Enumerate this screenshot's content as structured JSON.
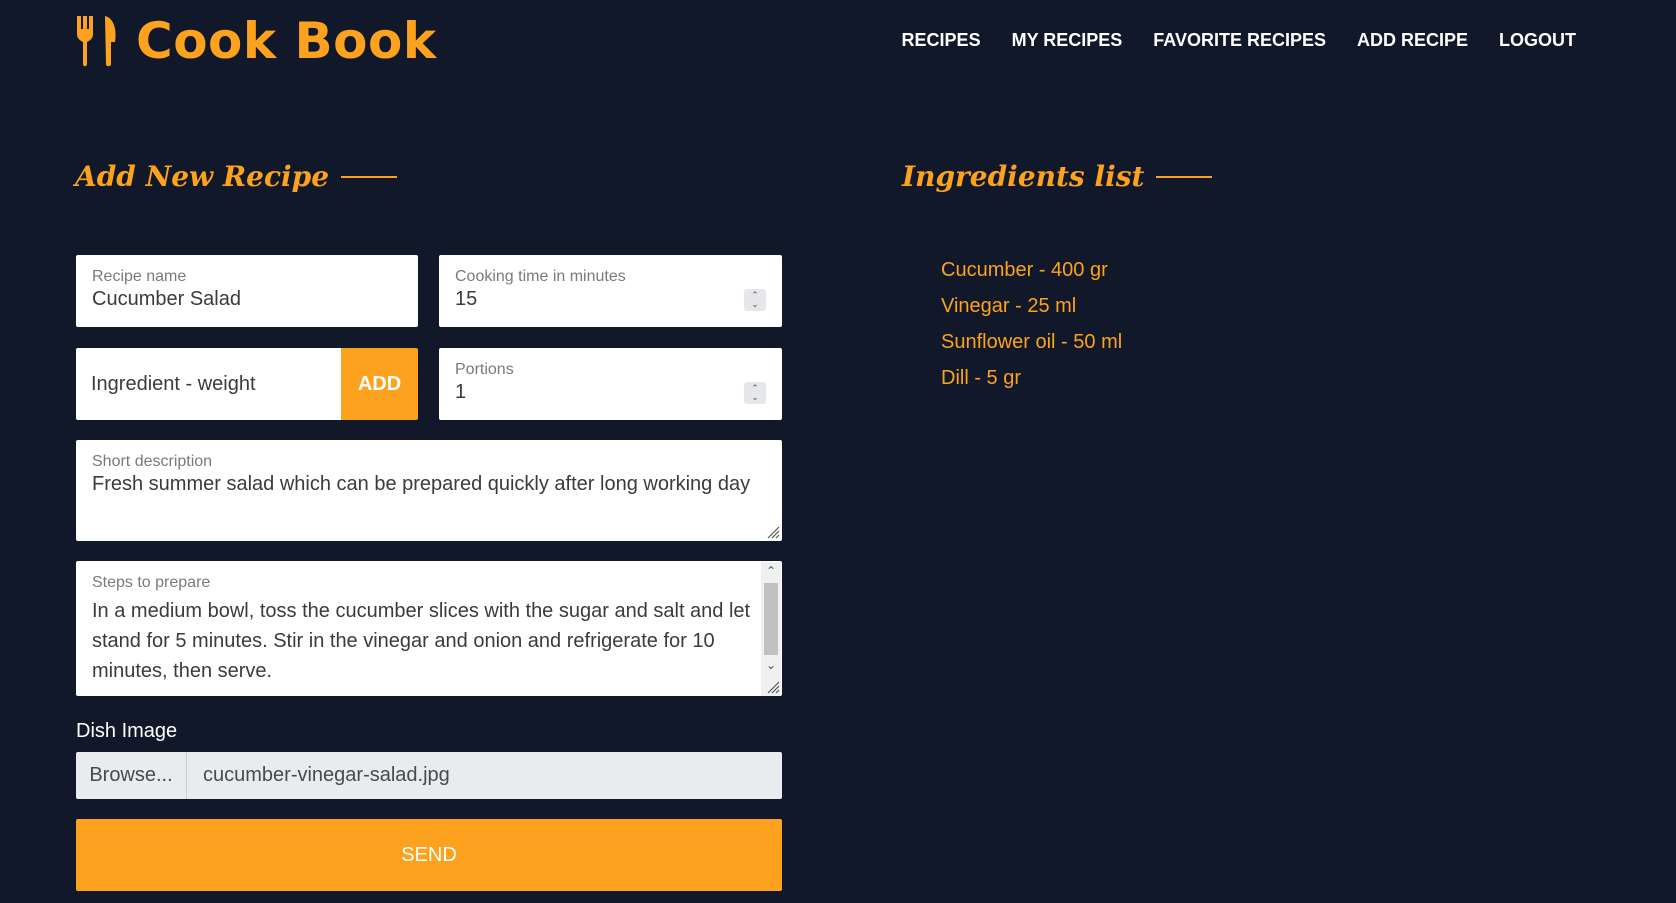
{
  "header": {
    "logo_text": "Cook Book",
    "logo_icon": "fork-knife-icon",
    "nav": [
      "RECIPES",
      "MY RECIPES",
      "FAVORITE RECIPES",
      "ADD RECIPE",
      "LOGOUT"
    ]
  },
  "form": {
    "title": "Add New Recipe",
    "recipe_name": {
      "label": "Recipe name",
      "value": "Cucumber Salad"
    },
    "cooking_time": {
      "label": "Cooking time in minutes",
      "value": "15"
    },
    "ingredient": {
      "placeholder": "Ingredient - weight",
      "add_label": "ADD"
    },
    "portions": {
      "label": "Portions",
      "value": "1"
    },
    "description": {
      "label": "Short description",
      "value": "Fresh summer salad which can be prepared quickly after long working day"
    },
    "steps": {
      "label": "Steps to prepare",
      "value": "In a medium bowl, toss the cucumber slices with the sugar and salt and let stand for 5 minutes. Stir in the vinegar and onion and refrigerate for 10 minutes, then serve."
    },
    "dish_image": {
      "label": "Dish Image",
      "browse_label": "Browse...",
      "file_name": "cucumber-vinegar-salad.jpg"
    },
    "send_label": "SEND"
  },
  "ingredients": {
    "title": "Ingredients list",
    "items": [
      "Cucumber - 400 gr",
      "Vinegar - 25 ml",
      "Sunflower oil - 50 ml",
      "Dill - 5 gr"
    ]
  },
  "colors": {
    "background": "#10182a",
    "accent": "#fca21e",
    "field_bg": "#ffffff"
  }
}
